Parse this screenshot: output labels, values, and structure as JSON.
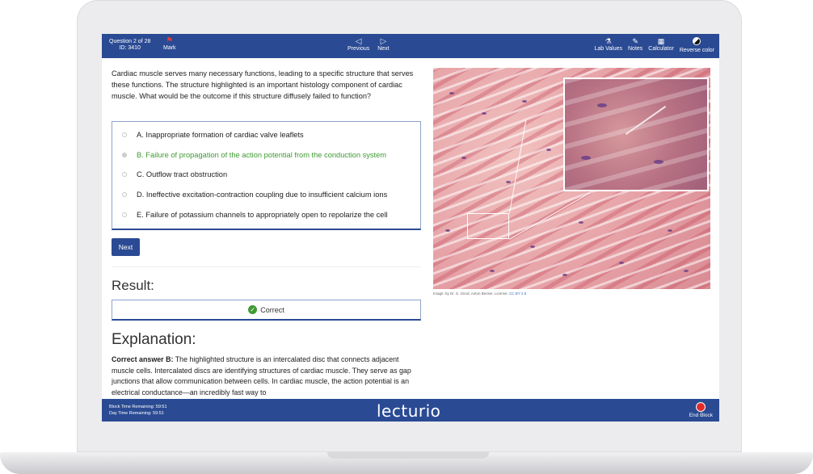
{
  "header": {
    "question_counter": "Question 2 of 28",
    "question_id": "ID: 3410",
    "mark_label": "Mark",
    "previous_label": "Previous",
    "next_label": "Next",
    "tools": [
      {
        "label": "Lab Values",
        "icon": "flask-icon"
      },
      {
        "label": "Notes",
        "icon": "notes-icon"
      },
      {
        "label": "Calculator",
        "icon": "calculator-icon"
      },
      {
        "label": "Reverse color",
        "icon": "reverse-color-icon"
      }
    ]
  },
  "question": {
    "text": "Cardiac muscle serves many necessary functions, leading to a specific structure that serves these functions. The structure highlighted is an important histology component of cardiac muscle. What would be the outcome if this structure diffusely failed to function?"
  },
  "choices": [
    {
      "label": "A. Inappropriate formation of cardiac valve leaflets",
      "selected": false
    },
    {
      "label": "B. Failure of propagation of the action potential from the conduction system",
      "selected": true
    },
    {
      "label": "C. Outflow tract obstruction",
      "selected": false
    },
    {
      "label": "D. Ineffective excitation-contraction coupling due to insufficient calcium ions",
      "selected": false
    },
    {
      "label": "E. Failure of potassium channels to appropriately open to repolarize the cell",
      "selected": false
    }
  ],
  "next_button": "Next",
  "result": {
    "title": "Result:",
    "status": "Correct"
  },
  "explanation": {
    "title": "Explanation:",
    "lead": "Correct answer B:",
    "text": " The highlighted structure is an intercalated disc that connects adjacent muscle cells. Intercalated discs are identifying structures of cardiac muscle. They serve as gap junctions that allow communication between cells. In cardiac muscle, the action potential is an electrical conductance—an incredibly fast way to"
  },
  "image": {
    "credit": "Image: by Dr. S. Girod, Anton Becker, License: ",
    "license": "CC BY 2.5"
  },
  "footer": {
    "block_time": "Block Time Remaining: 59:51",
    "day_time": "Day Time Remaining: 59:51",
    "logo": "lecturio",
    "end_block_label": "End Block"
  },
  "colors": {
    "brand_blue": "#2a4a93",
    "correct_green": "#3f9a33",
    "end_red": "#e22b2b"
  }
}
